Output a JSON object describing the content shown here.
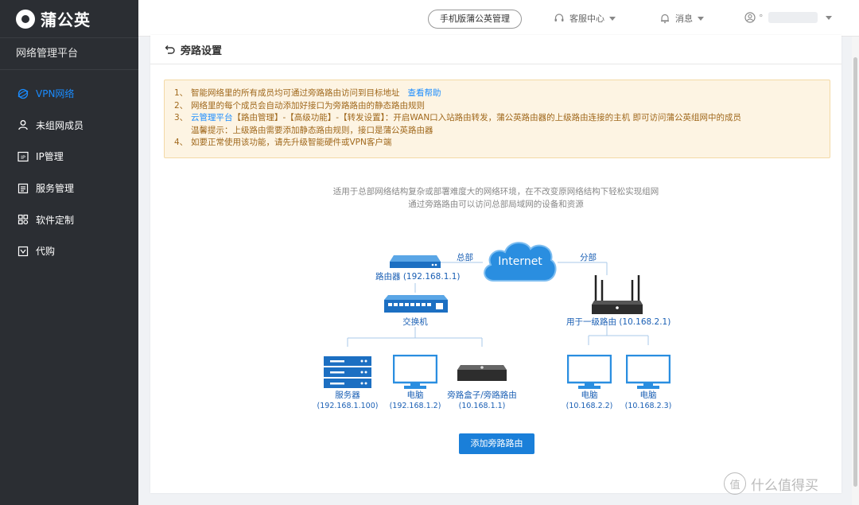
{
  "brand": {
    "name": "蒲公英",
    "platform": "网络管理平台"
  },
  "sidebar": {
    "items": [
      {
        "label": "VPN网络",
        "icon": "vpn-globe-icon",
        "active": true
      },
      {
        "label": "未组网成员",
        "icon": "user-icon",
        "active": false
      },
      {
        "label": "IP管理",
        "icon": "ip-icon",
        "active": false
      },
      {
        "label": "服务管理",
        "icon": "service-list-icon",
        "active": false
      },
      {
        "label": "软件定制",
        "icon": "grid-icon",
        "active": false
      },
      {
        "label": "代购",
        "icon": "purchase-icon",
        "active": false
      }
    ]
  },
  "topbar": {
    "mobile_label": "手机版蒲公英管理",
    "service_label": "客服中心",
    "message_label": "消息",
    "user_prefix": "°"
  },
  "page": {
    "title": "旁路设置"
  },
  "notice": {
    "line1_num": "1、",
    "line1_text": "智能网络里的所有成员均可通过旁路路由访问到目标地址",
    "line1_link": "查看帮助",
    "line2_num": "2、",
    "line2_text": "网络里的每个成员会自动添加好接口为旁路路由的静态路由规则",
    "line3_num": "3、",
    "line3_link": "云管理平台",
    "line3_text": "【路由管理】-【高级功能】-【转发设置】：开启WAN口入站路由转发，蒲公英路由器的上级路由连接的主机 即可访问蒲公英组网中的成员",
    "line3b_text": "温馨提示：上级路由需要添加静态路由规则，接口是蒲公英路由器",
    "line4_num": "4、",
    "line4_text": "如要正常使用该功能，请先升级智能硬件或VPN客户端"
  },
  "description": {
    "line1": "适用于总部网络结构复杂或部署难度大的网络环境，在不改变原网络结构下轻松实现组网",
    "line2": "通过旁路路由可以访问总部局域网的设备和资源"
  },
  "diagram": {
    "internet": "Internet",
    "hq_label": "总部",
    "branch_label": "分部",
    "router": "路由器 (192.168.1.1)",
    "switch": "交换机",
    "branch_router": "用于一级路由 (10.168.2.1)",
    "devices_left": [
      {
        "name": "服务器",
        "ip": "(192.168.1.100)"
      },
      {
        "name": "电脑",
        "ip": "(192.168.1.2)"
      },
      {
        "name": "旁路盒子/旁路路由",
        "ip": "(10.168.1.1)"
      }
    ],
    "devices_right": [
      {
        "name": "电脑",
        "ip": "(10.168.2.2)"
      },
      {
        "name": "电脑",
        "ip": "(10.168.2.3)"
      }
    ]
  },
  "actions": {
    "add_bypass": "添加旁路路由"
  },
  "watermark": {
    "symbol": "值",
    "text": "什么值得买"
  },
  "colors": {
    "accent": "#1a7fd9",
    "sidebar_bg": "#2b2e33",
    "notice_bg": "#fdf4e3",
    "notice_text": "#a0681c"
  }
}
